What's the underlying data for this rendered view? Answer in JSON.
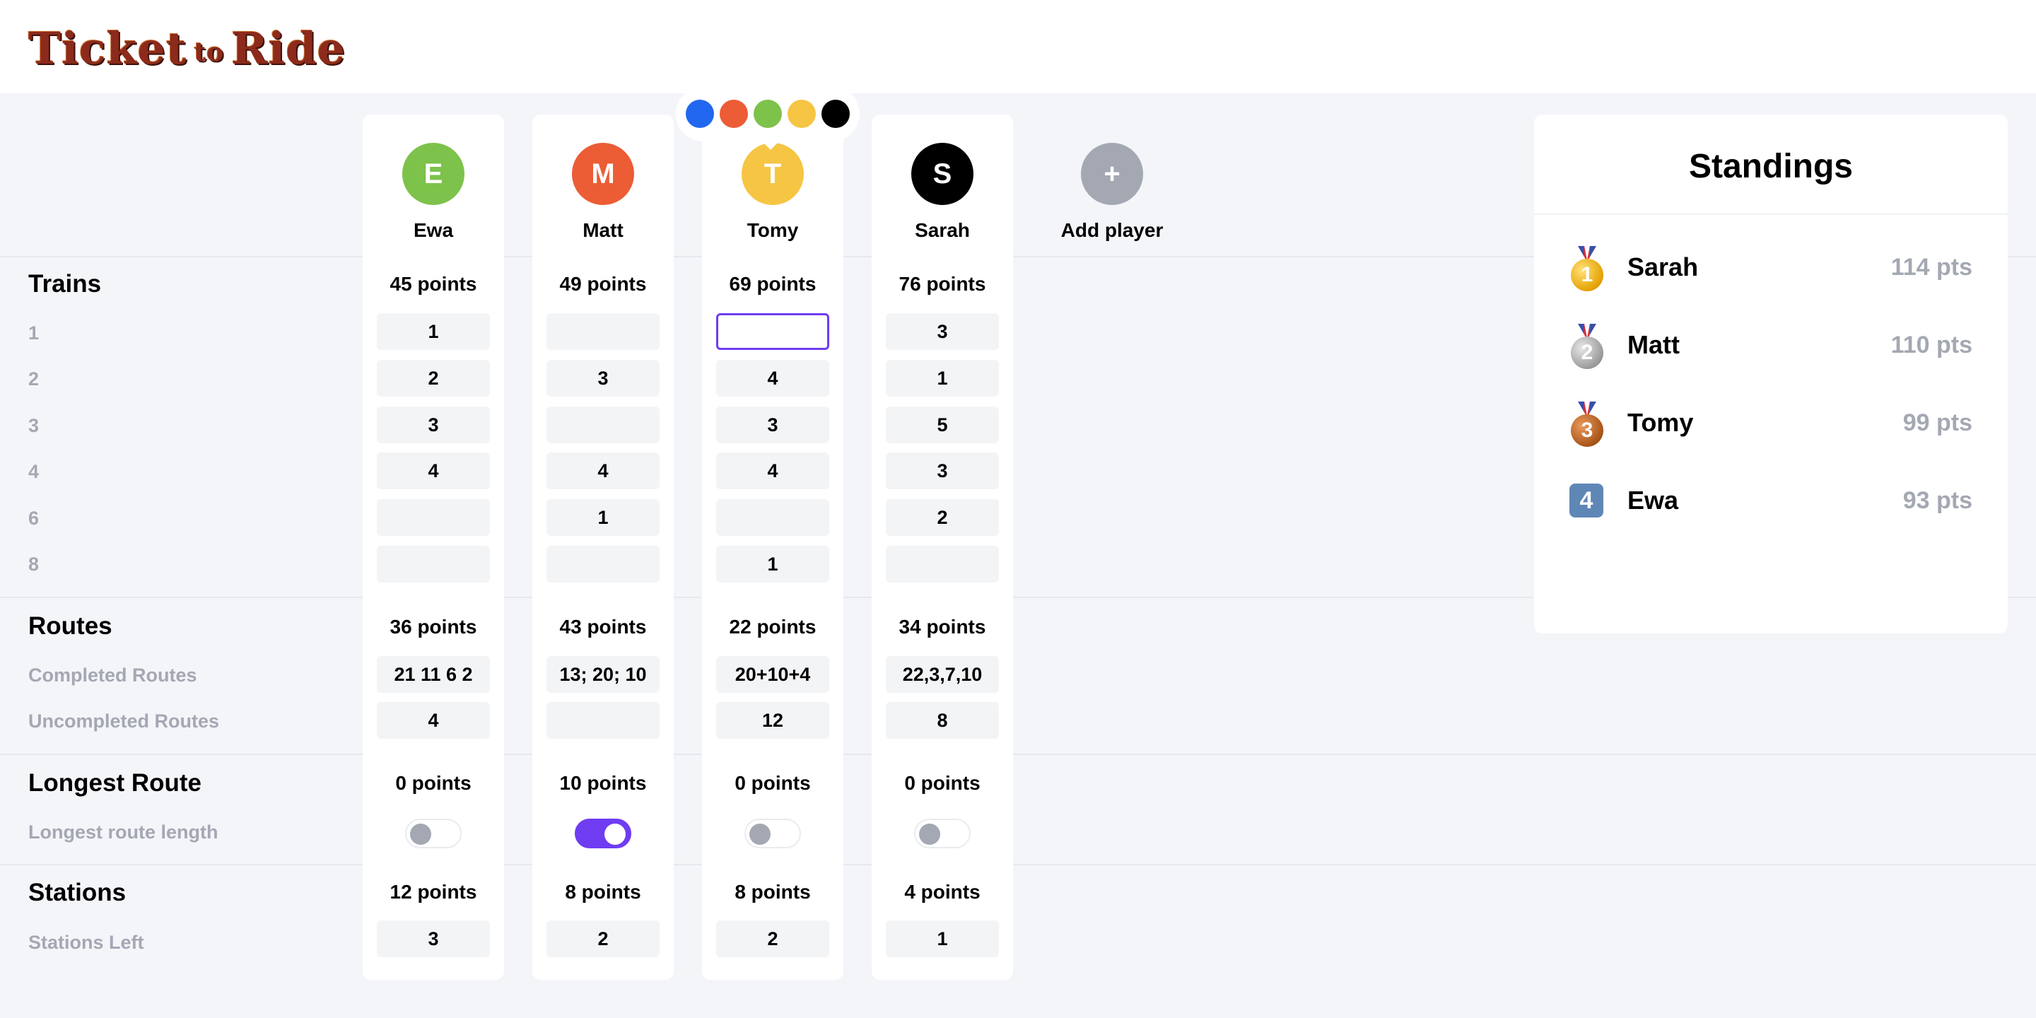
{
  "app": {
    "logo": {
      "word1": "Ticket",
      "word2": "to",
      "word3": "Ride"
    }
  },
  "colors": {
    "accent": "#6f3cf2",
    "muted_text": "#a4a8b3"
  },
  "color_picker": [
    "#2267f0",
    "#ec5c35",
    "#7dc24a",
    "#f6c544",
    "#000000"
  ],
  "players": [
    {
      "initial": "E",
      "name": "Ewa",
      "color": "#7dc24a",
      "trains_points": "45 points",
      "trains": [
        "1",
        "2",
        "3",
        "4",
        "",
        ""
      ],
      "routes_points": "36 points",
      "completed_routes": "21 11 6 2",
      "uncompleted_routes": "4",
      "longest_points": "0 points",
      "longest_on": false,
      "stations_points": "12 points",
      "stations_left": "3"
    },
    {
      "initial": "M",
      "name": "Matt",
      "color": "#ec5c35",
      "trains_points": "49 points",
      "trains": [
        "",
        "3",
        "",
        "4",
        "1",
        ""
      ],
      "routes_points": "43 points",
      "completed_routes": "13; 20; 10",
      "uncompleted_routes": "",
      "longest_points": "10 points",
      "longest_on": true,
      "stations_points": "8 points",
      "stations_left": "2"
    },
    {
      "initial": "T",
      "name": "Tomy",
      "color": "#f6c544",
      "trains_points": "69 points",
      "trains": [
        "",
        "4",
        "3",
        "4",
        "",
        "1"
      ],
      "routes_points": "22 points",
      "completed_routes": "20+10+4",
      "uncompleted_routes": "12",
      "longest_points": "0 points",
      "longest_on": false,
      "stations_points": "8 points",
      "stations_left": "2"
    },
    {
      "initial": "S",
      "name": "Sarah",
      "color": "#000000",
      "trains_points": "76 points",
      "trains": [
        "3",
        "1",
        "5",
        "3",
        "2",
        ""
      ],
      "routes_points": "34 points",
      "completed_routes": "22,3,7,10",
      "uncompleted_routes": "8",
      "longest_points": "0 points",
      "longest_on": false,
      "stations_points": "4 points",
      "stations_left": "1"
    }
  ],
  "add_player": {
    "icon": "+",
    "label": "Add player"
  },
  "sections": {
    "trains": {
      "title": "Trains",
      "rows": [
        "1",
        "2",
        "3",
        "4",
        "6",
        "8"
      ]
    },
    "routes": {
      "title": "Routes",
      "completed_label": "Completed Routes",
      "uncompleted_label": "Uncompleted Routes"
    },
    "longest": {
      "title": "Longest Route",
      "length_label": "Longest route length"
    },
    "stations": {
      "title": "Stations",
      "left_label": "Stations Left"
    }
  },
  "standings": {
    "title": "Standings",
    "rows": [
      {
        "rank": "1",
        "name": "Sarah",
        "points": "114 pts",
        "icon": "gold-medal-icon"
      },
      {
        "rank": "2",
        "name": "Matt",
        "points": "110 pts",
        "icon": "silver-medal-icon"
      },
      {
        "rank": "3",
        "name": "Tomy",
        "points": "99 pts",
        "icon": "bronze-medal-icon"
      },
      {
        "rank": "4",
        "name": "Ewa",
        "points": "93 pts",
        "icon": "keycap-4-icon"
      }
    ]
  }
}
